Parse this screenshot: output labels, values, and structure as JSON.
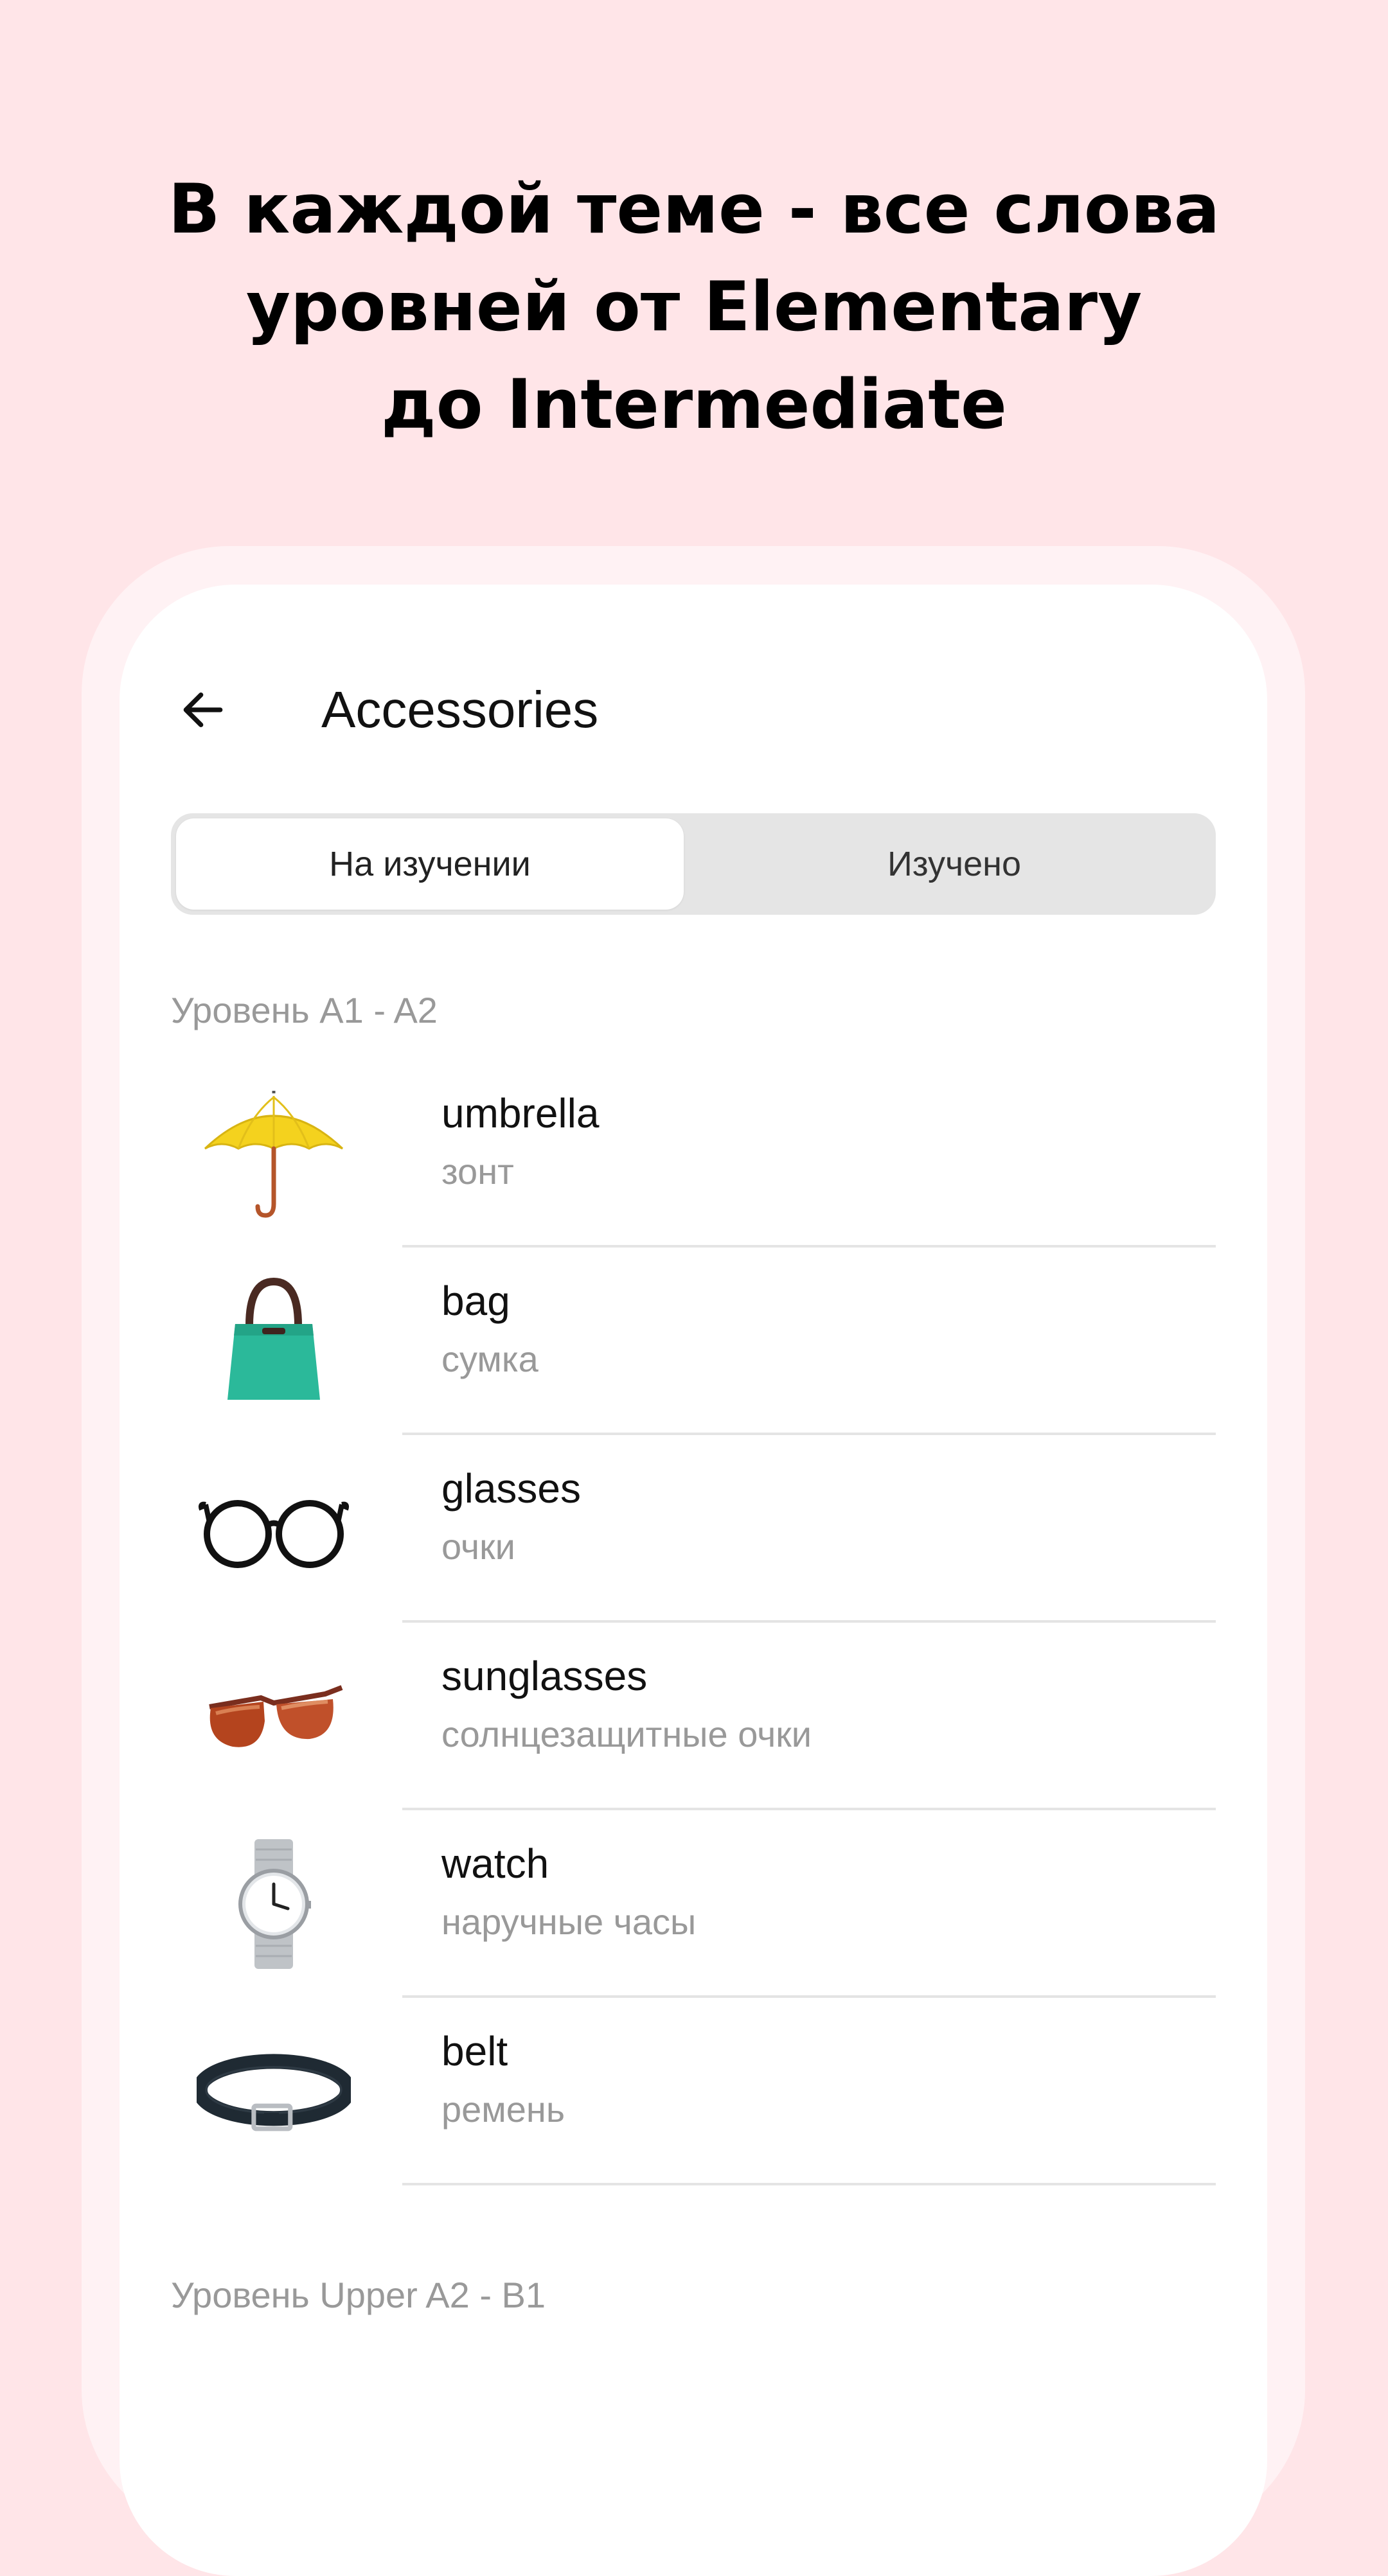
{
  "headline": {
    "line1": "В каждой теме - все слова",
    "line2": "уровней от Elementary",
    "line3": "до Intermediate"
  },
  "header": {
    "back_icon": "arrow-left-icon",
    "title": "Accessories"
  },
  "tabs": [
    {
      "label": "На изучении",
      "active": true
    },
    {
      "label": "Изучено",
      "active": false
    }
  ],
  "sections": [
    {
      "label": "Уровень A1 - A2",
      "words": [
        {
          "en": "umbrella",
          "ru": "зонт",
          "icon": "umbrella-image"
        },
        {
          "en": "bag",
          "ru": "сумка",
          "icon": "bag-image"
        },
        {
          "en": "glasses",
          "ru": "очки",
          "icon": "glasses-image"
        },
        {
          "en": "sunglasses",
          "ru": "солнцезащитные очки",
          "icon": "sunglasses-image"
        },
        {
          "en": "watch",
          "ru": "наручные часы",
          "icon": "watch-image"
        },
        {
          "en": "belt",
          "ru": "ремень",
          "icon": "belt-image"
        }
      ]
    },
    {
      "label": "Уровень Upper A2 - B1",
      "words": []
    }
  ],
  "colors": {
    "page_background": "#FFE5E8",
    "frame": "#FFF2F4",
    "screen": "#FFFFFF",
    "muted_text": "#999999",
    "segment_bg": "#E5E5E5"
  }
}
